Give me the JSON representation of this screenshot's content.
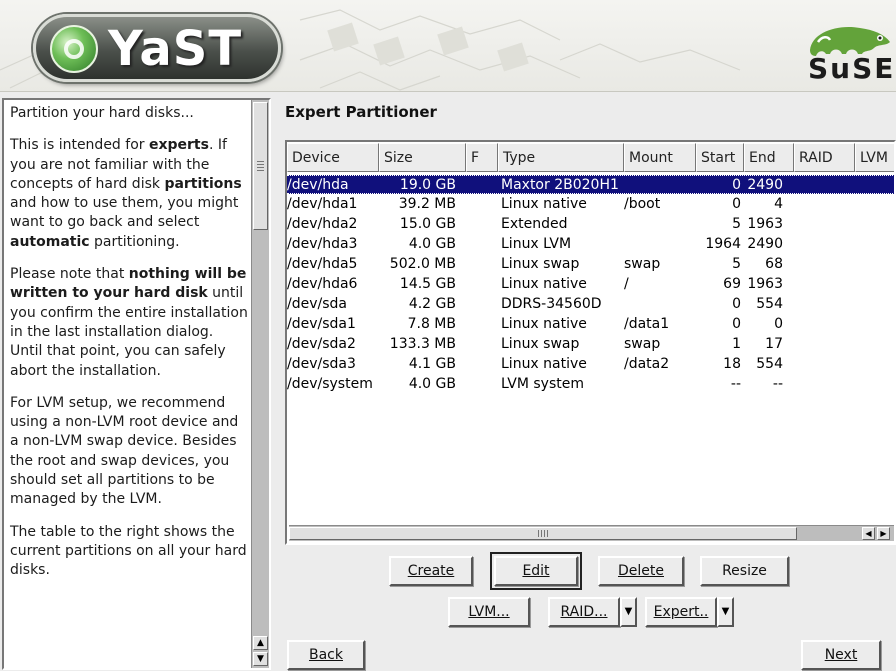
{
  "banner": {
    "app_logo_text": "YaST",
    "vendor_logo_text": "SuSE"
  },
  "help": {
    "p1": "Partition your hard disks...",
    "p2_a": "This is intended for ",
    "p2_b": "experts",
    "p2_c": ". If you are not familiar with the concepts of hard disk ",
    "p2_d": "partitions",
    "p2_e": " and how to use them, you might want to go back and select ",
    "p2_f": "automatic",
    "p2_g": " partitioning.",
    "p3_a": "Please note that ",
    "p3_b": "nothing will be written to your hard disk",
    "p3_c": " until you confirm the entire installation in the last installation dialog. Until that point, you can safely abort the installation.",
    "p4": "For LVM setup, we recommend using a non-LVM root device and a non-LVM swap device. Besides the root and swap devices, you should set all partitions to be managed by the LVM.",
    "p5": "The table to the right shows the current partitions on all your hard disks."
  },
  "main": {
    "title": "Expert Partitioner",
    "columns": [
      "Device",
      "Size",
      "F",
      "Type",
      "Mount",
      "Start",
      "End",
      "RAID",
      "LVM"
    ],
    "rows": [
      {
        "device": "/dev/hda",
        "size": "19.0 GB",
        "type": "Maxtor 2B020H1",
        "mount": "",
        "start": "0",
        "end": "2490",
        "selected": true
      },
      {
        "device": "/dev/hda1",
        "size": "39.2 MB",
        "type": "Linux native",
        "mount": "/boot",
        "start": "0",
        "end": "4"
      },
      {
        "device": "/dev/hda2",
        "size": "15.0 GB",
        "type": "Extended",
        "mount": "",
        "start": "5",
        "end": "1963"
      },
      {
        "device": "/dev/hda3",
        "size": "4.0 GB",
        "type": "Linux LVM",
        "mount": "",
        "start": "1964",
        "end": "2490"
      },
      {
        "device": "/dev/hda5",
        "size": "502.0 MB",
        "type": "Linux swap",
        "mount": "swap",
        "start": "5",
        "end": "68"
      },
      {
        "device": "/dev/hda6",
        "size": "14.5 GB",
        "type": "Linux native",
        "mount": "/",
        "start": "69",
        "end": "1963"
      },
      {
        "device": "/dev/sda",
        "size": "4.2 GB",
        "type": "DDRS-34560D",
        "mount": "",
        "start": "0",
        "end": "554"
      },
      {
        "device": "/dev/sda1",
        "size": "7.8 MB",
        "type": "Linux native",
        "mount": "/data1",
        "start": "0",
        "end": "0"
      },
      {
        "device": "/dev/sda2",
        "size": "133.3 MB",
        "type": "Linux swap",
        "mount": "swap",
        "start": "1",
        "end": "17"
      },
      {
        "device": "/dev/sda3",
        "size": "4.1 GB",
        "type": "Linux native",
        "mount": "/data2",
        "start": "18",
        "end": "554"
      },
      {
        "device": "/dev/system",
        "size": "4.0 GB",
        "type": "LVM system",
        "mount": "",
        "start": "--",
        "end": "--"
      }
    ]
  },
  "buttons": {
    "create": "Create",
    "edit": "Edit",
    "delete": "Delete",
    "resize": "Resize",
    "lvm": "LVM...",
    "raid": "RAID...",
    "expert": "Expert..",
    "back": "Back",
    "next": "Next"
  },
  "colors": {
    "selection": "#10107c",
    "window_bg": "#ececec",
    "suse_green": "#63a33a"
  }
}
